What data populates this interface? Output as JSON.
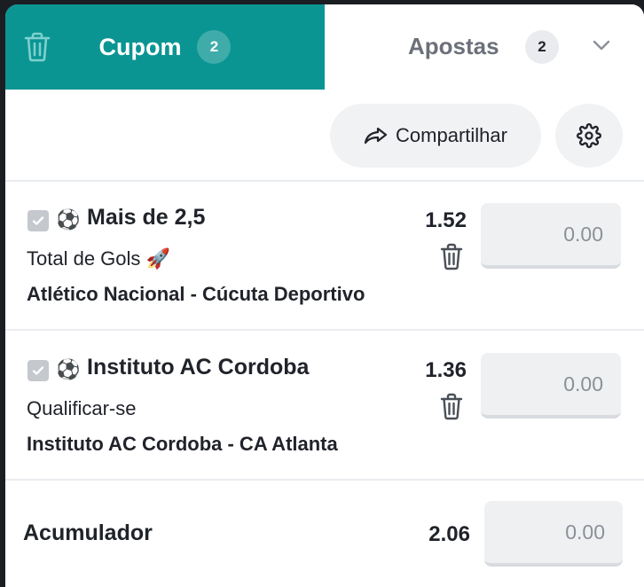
{
  "tabs": {
    "cupom": {
      "label": "Cupom",
      "count": "2"
    },
    "apostas": {
      "label": "Apostas",
      "count": "2"
    }
  },
  "toolbar": {
    "share_label": "Compartilhar"
  },
  "bets": [
    {
      "title": "Mais de 2,5",
      "market": "Total de Gols 🚀",
      "match": "Atlético Nacional  -  Cúcuta Deportivo",
      "odds": "1.52",
      "stake_placeholder": "0.00",
      "sport_icon": "⚽"
    },
    {
      "title": "Instituto AC Cordoba",
      "market": "Qualificar-se",
      "match": "Instituto AC Cordoba  -  CA Atlanta",
      "odds": "1.36",
      "stake_placeholder": "0.00",
      "sport_icon": "⚽"
    }
  ],
  "accumulator": {
    "label": "Acumulador",
    "odds": "2.06",
    "stake_placeholder": "0.00"
  },
  "colors": {
    "accent": "#0a9593",
    "text": "#20232a",
    "muted": "#6b7079"
  }
}
